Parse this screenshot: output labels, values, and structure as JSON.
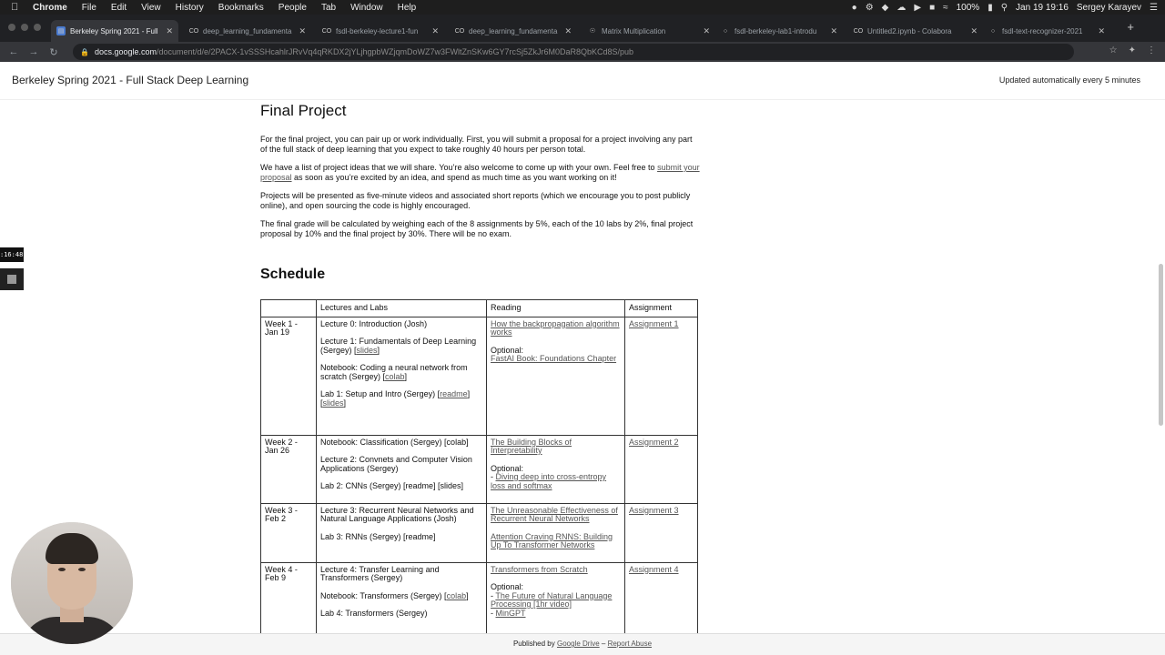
{
  "menubar": {
    "app_name": "Chrome",
    "items": [
      "File",
      "Edit",
      "View",
      "History",
      "Bookmarks",
      "People",
      "Tab",
      "Window",
      "Help"
    ],
    "battery": "100%",
    "clock": "Jan 19  19:16",
    "user": "Sergey Karayev"
  },
  "tabs": [
    {
      "label": "Berkeley Spring 2021 - Full",
      "icon": "docs-icon"
    },
    {
      "label": "deep_learning_fundamenta",
      "icon": "colab-icon"
    },
    {
      "label": "fsdl-berkeley-lecture1-fun",
      "icon": "colab-icon"
    },
    {
      "label": "deep_learning_fundamenta",
      "icon": "colab-icon"
    },
    {
      "label": "Matrix Multiplication",
      "icon": "globe-icon"
    },
    {
      "label": "fsdl-berkeley-lab1-introdu",
      "icon": "github-icon"
    },
    {
      "label": "Untitled2.ipynb - Colabora",
      "icon": "colab-icon"
    },
    {
      "label": "fsdl-text-recognizer-2021",
      "icon": "github-icon"
    }
  ],
  "address": {
    "host": "docs.google.com",
    "path": "/document/d/e/2PACX-1vSSSHcahlrJRvVq4qRKDX2jYLjhgpbWZjqmDoWZ7w3FWltZnSKw6GY7rcSj5ZkJr6M0DaR8QbKCd8S/pub"
  },
  "doc": {
    "title": "Berkeley Spring 2021 - Full Stack Deep Learning",
    "update_note": "Updated automatically every 5 minutes"
  },
  "final_project": {
    "heading": "Final Project",
    "p1": "For the final project, you can pair up or work individually. First, you will submit a proposal for a project involving any part of the full stack of deep learning that you expect to take roughly 40 hours per person total.",
    "p2_pre": "We have a list of project ideas that we will share. You’re also welcome to come up with your own. Feel free to ",
    "p2_link": "submit your proposal",
    "p2_post": " as soon as you’re excited by an idea, and spend as much time as you want working on it!",
    "p3": "Projects will be presented as five-minute videos and associated short reports (which we encourage you to post publicly online), and open sourcing the code is highly encouraged.",
    "p4": "The final grade will be calculated by weighing each of the 8 assignments by 5%, each of the 10 labs by 2%, final project proposal by 10% and the final project by 30%. There will be no exam."
  },
  "schedule": {
    "heading": "Schedule",
    "columns": [
      "",
      "Lectures and Labs",
      "Reading",
      "Assignment"
    ],
    "weeks": [
      {
        "week": "Week 1 - Jan 19",
        "lecture_lines": [
          {
            "text": "Lecture 0: Introduction (Josh)"
          },
          {
            "text": "Lecture 1: Fundamentals of Deep Learning (Sergey) [",
            "link": "slides",
            "tail": "]"
          },
          {
            "text": "Notebook: Coding a neural network from scratch (Sergey) [",
            "link": "colab",
            "tail": "]"
          },
          {
            "text": "Lab 1: Setup and Intro (Sergey) [",
            "link": "readme",
            "tail": "] [",
            "link2": "slides",
            "tail2": "]"
          }
        ],
        "reading": [
          {
            "link": "How the backpropagation algorithm works"
          },
          {
            "label": "Optional:",
            "link": "FastAI Book: Foundations Chapter"
          }
        ],
        "assignment": "Assignment 1"
      },
      {
        "week": "Week 2 - Jan 26",
        "lecture_lines": [
          {
            "text": "Notebook: Classification (Sergey) [colab]"
          },
          {
            "text": "Lecture 2: Convnets and Computer Vision Applications (Sergey)"
          },
          {
            "text": "Lab 2: CNNs (Sergey) [readme] [slides]"
          }
        ],
        "reading": [
          {
            "link": "The Building Blocks of Interpretability"
          },
          {
            "label": "Optional:",
            "prefix": "- ",
            "link": "Diving deep into cross-entropy loss and softmax"
          }
        ],
        "assignment": "Assignment 2"
      },
      {
        "week": "Week 3 - Feb 2",
        "lecture_lines": [
          {
            "text": "Lecture 3: Recurrent Neural Networks and Natural Language Applications (Josh)"
          },
          {
            "text": "Lab 3: RNNs (Sergey) [readme]"
          }
        ],
        "reading": [
          {
            "link": "The Unreasonable Effectiveness of Recurrent Neural Networks"
          },
          {
            "link": "Attention Craving RNNS: Building Up To Transformer Networks"
          }
        ],
        "assignment": "Assignment 3"
      },
      {
        "week": "Week 4 - Feb 9",
        "lecture_lines": [
          {
            "text": "Lecture 4: Transfer Learning and Transformers (Sergey)"
          },
          {
            "text": "Notebook: Transformers (Sergey) [",
            "link": "colab",
            "tail": "]"
          },
          {
            "text": "Lab 4: Transformers (Sergey)"
          }
        ],
        "reading": [
          {
            "link": "Transformers from Scratch"
          },
          {
            "label": "Optional:",
            "prefix": "- ",
            "link": "The Future of Natural Language Processing [1hr video]"
          },
          {
            "prefix": "- ",
            "link": "MinGPT"
          }
        ],
        "assignment": "Assignment 4"
      }
    ]
  },
  "footer": {
    "published_by": "Published by ",
    "drive": "Google Drive",
    "sep": " – ",
    "report": "Report Abuse"
  },
  "recorder": {
    "timer": ":16:48"
  }
}
